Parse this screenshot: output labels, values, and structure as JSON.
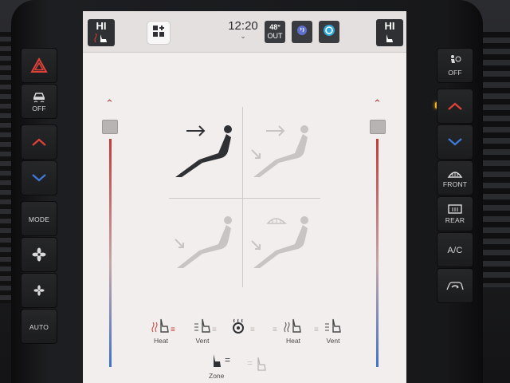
{
  "colors": {
    "heat_red": "#c23b36",
    "cool_blue": "#3e73c9",
    "screen_bg": "#f3eeee",
    "topbar_bg": "#e4e0e0",
    "led_amber": "#f5b21a"
  },
  "left_buttons": [
    {
      "label": "",
      "icon": "hazard-triangle-icon"
    },
    {
      "label": "OFF",
      "icon": "traction-control-icon"
    },
    {
      "label": "",
      "icon": "temp-up-chevron-icon"
    },
    {
      "label": "",
      "icon": "temp-down-chevron-icon"
    },
    {
      "label": "MODE",
      "icon": ""
    },
    {
      "label": "",
      "icon": "fan-high-icon"
    },
    {
      "label": "",
      "icon": "fan-low-icon"
    },
    {
      "label": "AUTO",
      "icon": ""
    }
  ],
  "right_buttons": [
    {
      "label": "OFF",
      "icon": "passenger-airbag-icon"
    },
    {
      "label": "",
      "icon": "temp-up-chevron-icon"
    },
    {
      "label": "",
      "icon": "temp-down-chevron-icon"
    },
    {
      "label": "FRONT",
      "icon": "front-defrost-icon"
    },
    {
      "label": "REAR",
      "icon": "rear-defrost-icon"
    },
    {
      "label": "A/C",
      "icon": ""
    },
    {
      "label": "",
      "icon": "recirculation-icon"
    }
  ],
  "topbar": {
    "driver_seat": {
      "level": "HI"
    },
    "passenger_seat": {
      "level": "HI"
    },
    "clock": "12:20",
    "outside_temp": {
      "value": "48°",
      "label": "OUT"
    }
  },
  "climate": {
    "driver_temp_level": 0.0,
    "passenger_temp_level": 0.0,
    "active_mode": "panel",
    "modes": [
      "panel",
      "panel-floor",
      "floor",
      "floor-defrost"
    ]
  },
  "seat_controls": {
    "driver_heat_label": "Heat",
    "driver_vent_label": "Vent",
    "passenger_heat_label": "Heat",
    "passenger_vent_label": "Vent",
    "zone_label": "Zone"
  }
}
